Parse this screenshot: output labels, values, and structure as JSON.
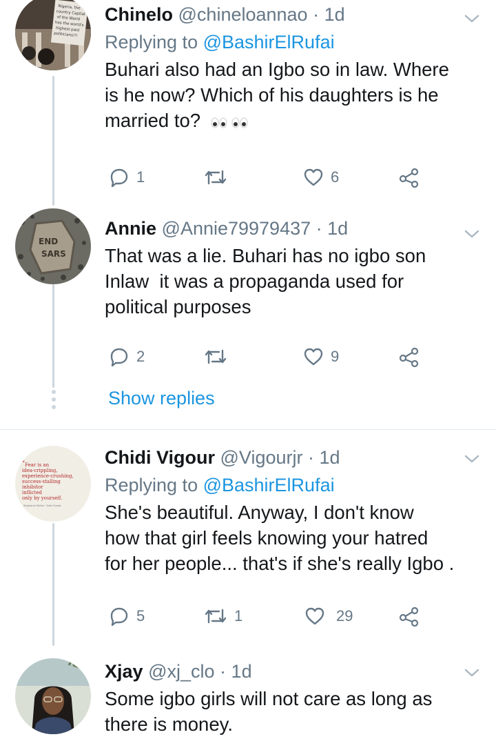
{
  "tweets": [
    {
      "name": "Chinelo",
      "handle": "@chineloannao",
      "separator": "·",
      "time": "1d",
      "replying_prefix": "Replying to",
      "replying_to": "@BashirElRufai",
      "lines": [
        "Buhari also had an Igbo so in law. Where",
        "is he now? Which of his daughters is he",
        "married to?"
      ],
      "emoji": "👀👀",
      "replies": "1",
      "retweets": "",
      "likes": "6",
      "avatar_text": [
        "Nigeria, the",
        "country Capital",
        "of the World",
        "has the world's",
        "highest paid",
        "politicians!!!"
      ]
    },
    {
      "name": "Annie",
      "handle": "@Annie79979437",
      "separator": "·",
      "time": "1d",
      "lines": [
        "That was a lie. Buhari has no igbo son",
        "Inlaw  it was a propaganda used for",
        "political purposes"
      ],
      "replies": "2",
      "retweets": "",
      "likes": "9",
      "avatar_text": [
        "END",
        "SARS"
      ]
    },
    {
      "name": "Chidi Vigour",
      "handle": "@Vigourjr",
      "separator": "·",
      "time": "1d",
      "replying_prefix": "Replying to",
      "replying_to": "@BashirElRufai",
      "lines": [
        "She's beautiful. Anyway, I don't know",
        "how that girl feels knowing your hatred",
        "for her people... that's if she's really Igbo ."
      ],
      "replies": "5",
      "retweets": "1",
      "likes": "29",
      "avatar_text": [
        "Fear is an",
        "idea-crippling,",
        "experience-crushing,",
        "success-stalling",
        "inhibitor",
        "inflicted",
        "only by yourself.",
        "Stephanie Melish · Satin Runda"
      ]
    },
    {
      "name": "Xjay",
      "handle": "@xj_clo",
      "separator": "·",
      "time": "1d",
      "lines": [
        "Some igbo girls will not care as long as",
        "there is money."
      ]
    }
  ],
  "show_replies": "Show replies",
  "colors": {
    "text": "#14171a",
    "secondary": "#657786",
    "link": "#1b95e0",
    "line": "#ccd6dd",
    "divider": "#e1e8ed"
  },
  "icons": [
    "reply-icon",
    "retweet-icon",
    "like-icon",
    "share-icon",
    "chevron-down-icon",
    "eyes-emoji"
  ]
}
